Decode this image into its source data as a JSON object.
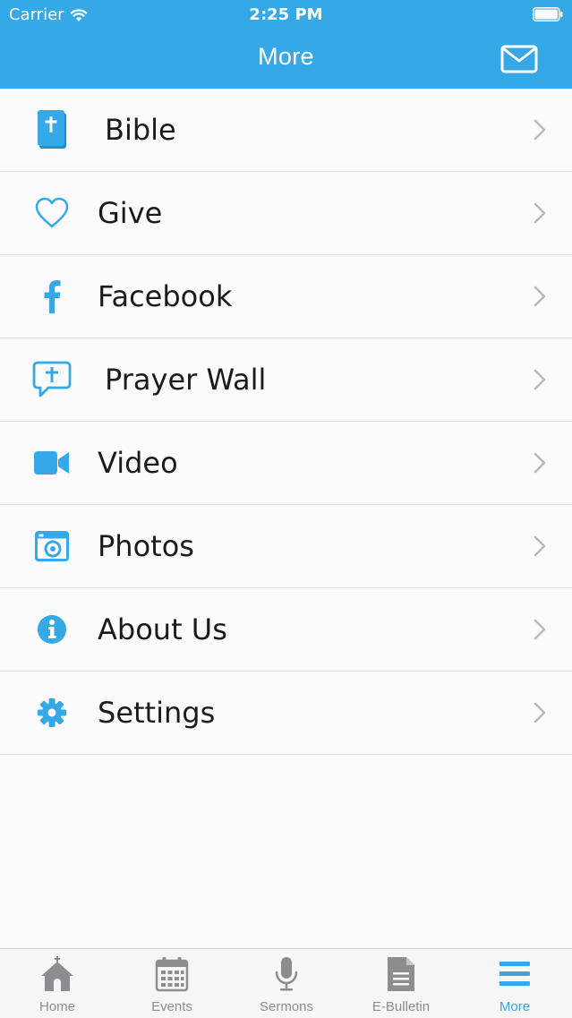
{
  "status_bar": {
    "carrier": "Carrier",
    "time": "2:25 PM"
  },
  "nav": {
    "title": "More",
    "action_icon": "mail-icon"
  },
  "colors": {
    "accent": "#35a9e8",
    "tab_inactive": "#8d8d91",
    "text": "#1b1b1b"
  },
  "menu": {
    "items": [
      {
        "label": "Bible",
        "icon": "bible-icon"
      },
      {
        "label": "Give",
        "icon": "heart-icon"
      },
      {
        "label": "Facebook",
        "icon": "facebook-icon"
      },
      {
        "label": "Prayer Wall",
        "icon": "prayer-chat-icon"
      },
      {
        "label": "Video",
        "icon": "video-camera-icon"
      },
      {
        "label": "Photos",
        "icon": "camera-icon"
      },
      {
        "label": "About Us",
        "icon": "info-icon"
      },
      {
        "label": "Settings",
        "icon": "gear-icon"
      }
    ]
  },
  "tabs": [
    {
      "label": "Home",
      "icon": "church-icon",
      "active": false
    },
    {
      "label": "Events",
      "icon": "calendar-icon",
      "active": false
    },
    {
      "label": "Sermons",
      "icon": "microphone-icon",
      "active": false
    },
    {
      "label": "E-Bulletin",
      "icon": "document-icon",
      "active": false
    },
    {
      "label": "More",
      "icon": "hamburger-icon",
      "active": true
    }
  ]
}
